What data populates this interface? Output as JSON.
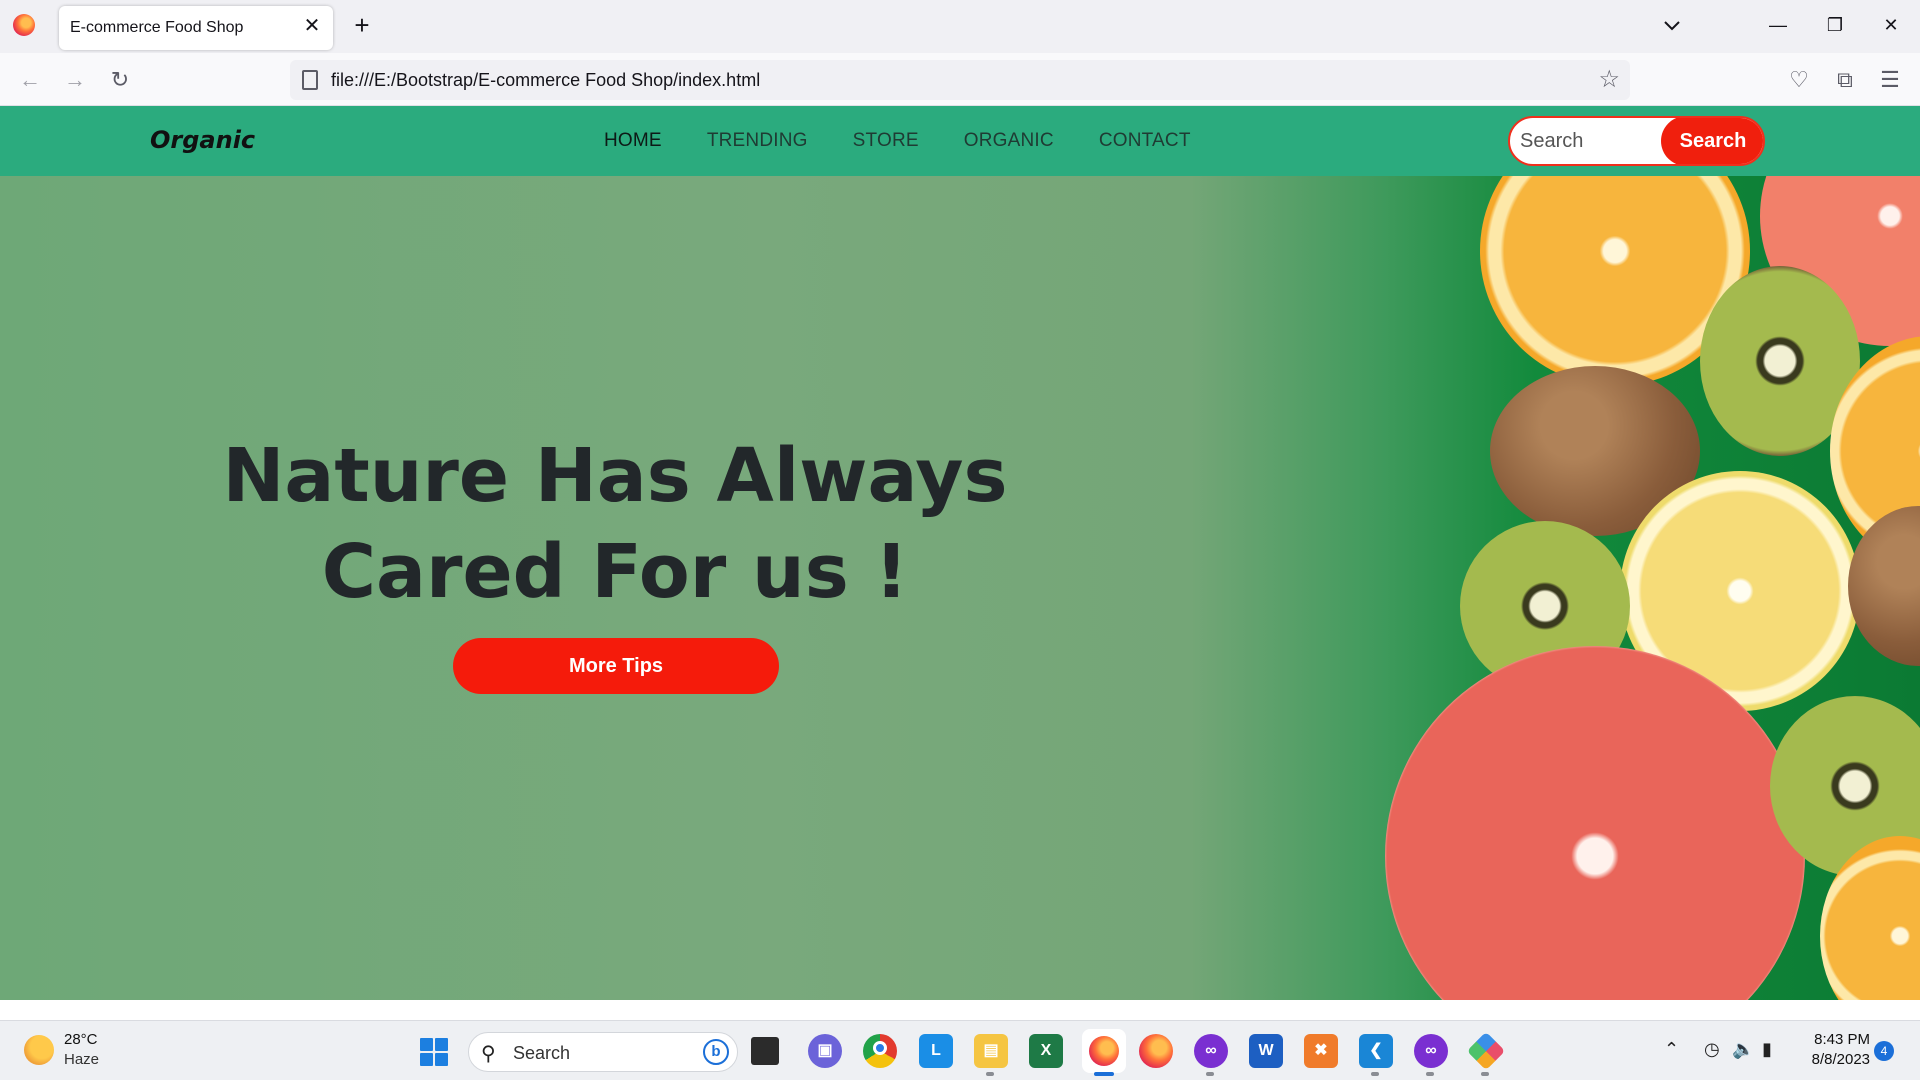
{
  "browser": {
    "tab_title": "E-commerce Food Shop",
    "url": "file:///E:/Bootstrap/E-commerce Food Shop/index.html",
    "new_tab_glyph": "+",
    "close_glyph": "✕"
  },
  "site": {
    "brand": "Organic",
    "menu": [
      "HOME",
      "TRENDING",
      "STORE",
      "ORGANIC",
      "CONTACT"
    ],
    "active_menu": "HOME",
    "search_placeholder": "Search",
    "search_button": "Search",
    "hero_line1": "Nature Has Always",
    "hero_line2": "Cared For us !",
    "cta": "More Tips",
    "colors": {
      "nav": "#2bab7e",
      "accent": "#f01f0d",
      "hero_text": "#22272a"
    }
  },
  "taskbar": {
    "temperature": "28°C",
    "condition": "Haze",
    "search_label": "Search",
    "time": "8:43 PM",
    "date": "8/8/2023",
    "notifications": "4",
    "apps": [
      "widgets-icon",
      "start-icon",
      "task-view-icon",
      "teams-icon",
      "chrome-icon",
      "l-app-icon",
      "file-explorer-icon",
      "excel-icon",
      "firefox-icon",
      "firefox-icon",
      "app-icon",
      "word-icon",
      "xampp-icon",
      "vscode-icon",
      "app-icon",
      "git-icon"
    ]
  }
}
